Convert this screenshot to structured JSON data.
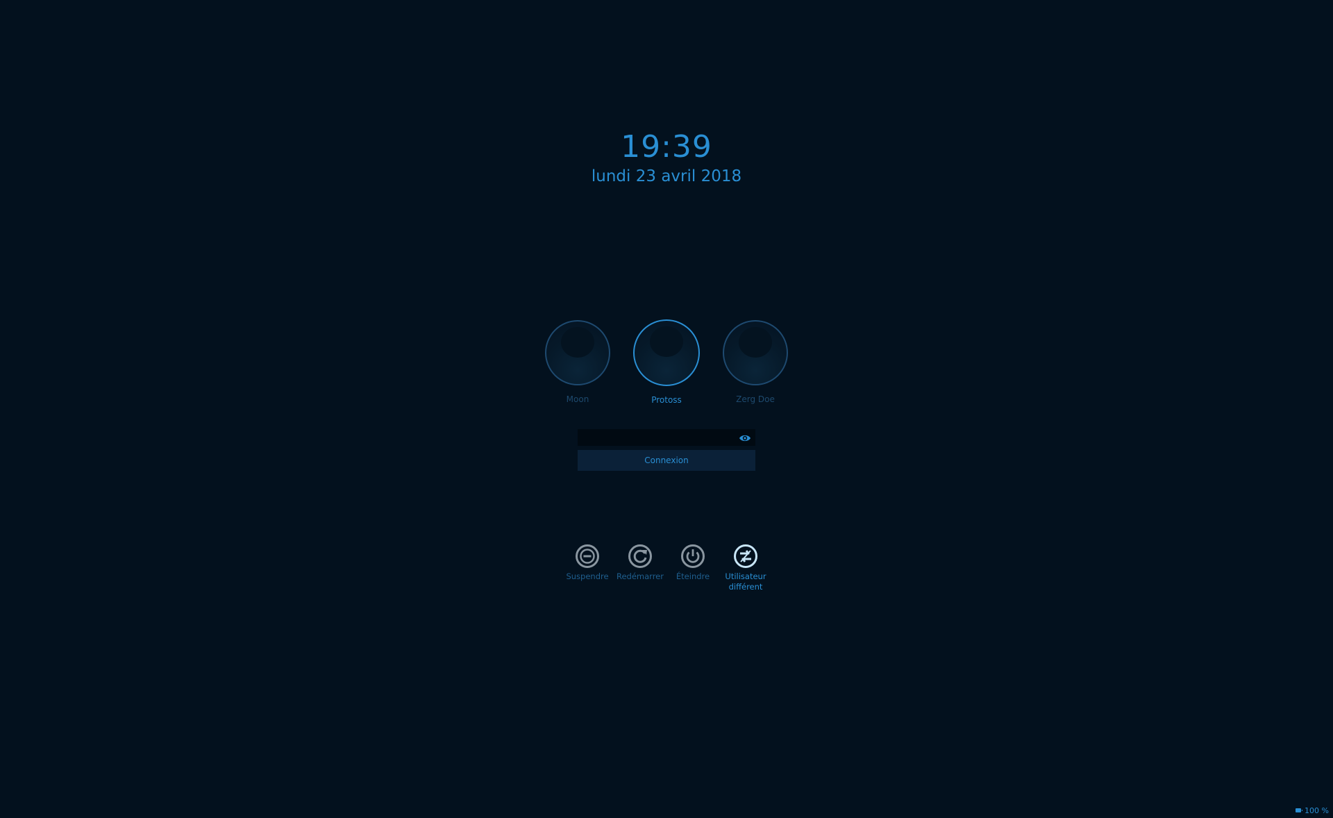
{
  "clock": {
    "time": "19:39",
    "date": "lundi 23 avril 2018"
  },
  "users": [
    {
      "name": "Moon",
      "selected": false
    },
    {
      "name": "Protoss",
      "selected": true
    },
    {
      "name": "Zerg Doe",
      "selected": false
    }
  ],
  "login": {
    "password_value": "",
    "password_placeholder": "",
    "show_password_icon": "eye-icon",
    "button_label": "Connexion"
  },
  "actions": [
    {
      "label": "Suspendre",
      "icon": "suspend-icon"
    },
    {
      "label": "Redémarrer",
      "icon": "restart-icon"
    },
    {
      "label": "Éteindre",
      "icon": "power-icon"
    },
    {
      "label": "Utilisateur différent",
      "icon": "switch-user-icon",
      "selected": true
    }
  ],
  "status": {
    "battery": "100 %"
  },
  "colors": {
    "background": "#03111e",
    "accent": "#2a8fd4",
    "muted": "#1e4a6e",
    "button_bg": "#0b2138"
  }
}
